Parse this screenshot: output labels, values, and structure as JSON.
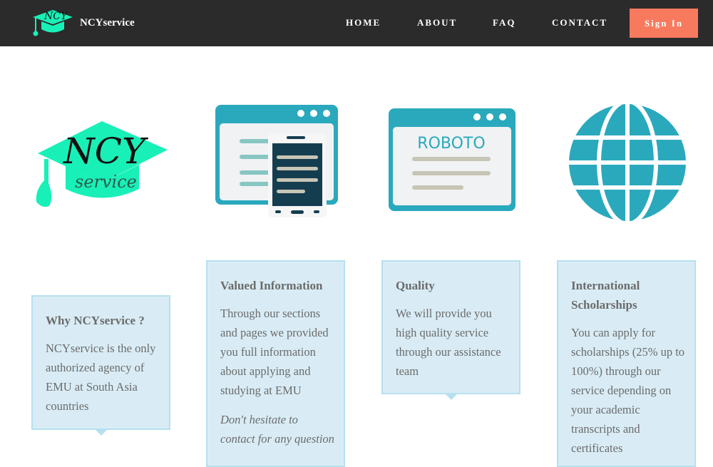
{
  "nav": {
    "brand_name": "NCYservice",
    "logo_text": "NCY",
    "links": [
      "HOME",
      "ABOUT",
      "FAQ",
      "CONTACT"
    ],
    "signin_label": "Sign In"
  },
  "icons": {
    "logo_big_text": "NCY",
    "logo_big_sub": "service",
    "browser_text": "ROBOTO"
  },
  "cards": [
    {
      "title": "Why NCYservice ?",
      "body": "NCYservice is the only authorized agency of EMU at South Asia countries"
    },
    {
      "title": "Valued Information",
      "body": "Through our sections and pages we provided you full information about applying and studying at EMU",
      "extra": "Don't hesitate to contact for any question"
    },
    {
      "title": "Quality",
      "body": "We will provide you high quality service through our assistance team"
    },
    {
      "title": "International Scholarships",
      "body": "You can apply for scholarships (25% up to 100%) through our service depending on your academic transcripts and certificates"
    }
  ],
  "colors": {
    "navbar": "#2b2b2b",
    "signin": "#f87a5e",
    "card_bg": "#d9ecf5",
    "card_border": "#b6e0ee",
    "teal": "#2aa9bd",
    "mint": "#19f0b8"
  }
}
